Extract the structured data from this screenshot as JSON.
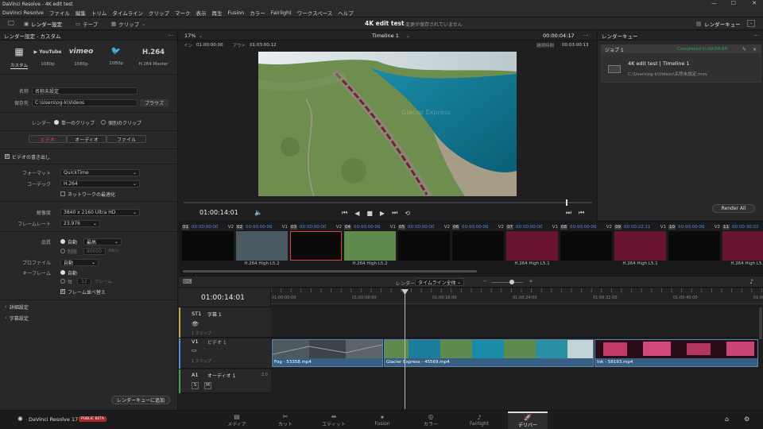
{
  "titlebar": {
    "app_title": "DaVinci Resolve - 4K edit test",
    "minimize": "—",
    "maximize": "☐",
    "close": "✕"
  },
  "menu": [
    "DaVinci Resolve",
    "ファイル",
    "編集",
    "トリム",
    "タイムライン",
    "クリップ",
    "マーク",
    "表示",
    "再生",
    "Fusion",
    "カラー",
    "Fairlight",
    "ワークスペース",
    "ヘルプ"
  ],
  "toolbar": {
    "render_settings": "レンダー設定",
    "tape": "テープ",
    "clips": "クリップ",
    "project_title": "4K edit test",
    "unsaved": "変更が保存されていません",
    "render_queue": "レンダーキュー"
  },
  "render": {
    "panel_title": "レンダー設定 - カスタム",
    "more": "···",
    "presets": [
      {
        "logo": "▦",
        "label": "カスタム"
      },
      {
        "logo": "▶ YouTube",
        "label": "1080p"
      },
      {
        "logo": "vimeo",
        "label": "1080p"
      },
      {
        "logo": "🐦",
        "label": "1080p"
      },
      {
        "logo": "H.264",
        "label": "H.264 Master"
      }
    ],
    "name_label": "名称",
    "name_value": "名称未設定",
    "location_label": "保存先",
    "location_value": "C:\\Users\\og-k\\Videos",
    "browse": "ブラウズ",
    "render_label": "レンダー",
    "single_clip": "単一のクリップ",
    "individual_clips": "個別のクリップ",
    "tabs": [
      "ビデオ",
      "オーディオ",
      "ファイル"
    ],
    "export_video": "ビデオの書き出し",
    "format_label": "フォーマット",
    "format_value": "QuickTime",
    "codec_label": "コーデック",
    "codec_value": "H.264",
    "network_opt": "ネットワークの最適化",
    "resolution_label": "解像度",
    "resolution_value": "3840 x 2160 Ultra HD",
    "framerate_label": "フレームレート",
    "framerate_value": "23.976",
    "quality_label": "品質",
    "auto": "自動",
    "quality_value": "最高",
    "limit_label": "制限",
    "limit_value": "80000",
    "kbs": "Kb/s",
    "profile_label": "プロファイル",
    "profile_value": "自動",
    "keyframe_label": "キーフレーム",
    "kf_auto": "自動",
    "kf_every": "毎",
    "kf_value": "12",
    "kf_frames": "フレーム",
    "reorder": "フレーム並べ替え",
    "advanced": "詳細設定",
    "subtitle_settings": "字幕設定",
    "add_queue": "レンダーキューに追加"
  },
  "viewer": {
    "zoom": "17%",
    "timeline_name": "Timeline 1",
    "timecode_top": "00:00:04:17",
    "in_label": "イン",
    "in_value": "01:00:00:00",
    "out_label": "アウト",
    "out_value": "01:03:00:12",
    "duration_label": "継続時間",
    "duration_value": "00:03:00:13",
    "current_tc": "01:00:14:01",
    "watermark": "Glacier Express"
  },
  "queue": {
    "title": "レンダーキュー",
    "job": "ジョブ 1",
    "completed": "Completed in 00:04:50",
    "job_title": "4K edit test | Timeline 1",
    "job_path": "C:\\Users\\og-k\\Videos\\名称未設定.mov",
    "render_all": "Render All"
  },
  "clips": [
    {
      "num": "01",
      "tc": "00:00:00:00",
      "track": "V2",
      "caption": ""
    },
    {
      "num": "02",
      "tc": "00:00:00:00",
      "track": "V1",
      "caption": "H.264 High L5.2"
    },
    {
      "num": "03",
      "tc": "00:00:00:00",
      "track": "V2",
      "caption": ""
    },
    {
      "num": "04",
      "tc": "00:00:00:00",
      "track": "V1",
      "caption": "H.264 High L5.2"
    },
    {
      "num": "05",
      "tc": "00:00:00:00",
      "track": "V2",
      "caption": ""
    },
    {
      "num": "06",
      "tc": "00:00:00:00",
      "track": "V2",
      "caption": ""
    },
    {
      "num": "07",
      "tc": "00:00:00:00",
      "track": "V1",
      "caption": "H.264 High L5.1"
    },
    {
      "num": "08",
      "tc": "00:00:00:00",
      "track": "V2",
      "caption": ""
    },
    {
      "num": "09",
      "tc": "00:00:22:11",
      "track": "V1",
      "caption": "H.264 High L5.1"
    },
    {
      "num": "10",
      "tc": "00:00:00:00",
      "track": "V2",
      "caption": ""
    },
    {
      "num": "11",
      "tc": "00:00:30:02",
      "track": "",
      "caption": "H.264 High L5.1"
    }
  ],
  "timeline": {
    "render_label": "レンダー",
    "render_value": "タイムライン全体",
    "current_tc": "01:00:14:01",
    "ruler": [
      "01:00:00:00",
      "01:00:08:00",
      "01:00:16:00",
      "01:00:24:00",
      "01:00:32:00",
      "01:00:40:00",
      "01:00:48:00"
    ],
    "st1": "ST1",
    "st1_name": "字幕 1",
    "st1_sub": "1 クリップ",
    "v1": "V1",
    "v1_name": "ビデオ 1",
    "v1_sub": "1 クリップ",
    "a1": "A1",
    "a1_name": "オーディオ 1",
    "a1_ch": "2.0",
    "s": "S",
    "m": "M",
    "clip1": "Fog - 53358.mp4",
    "clip2": "Glacier Express - 45569.mp4",
    "clip3": "Ink - 58193.mp4"
  },
  "footer": {
    "brand": "DaVinci Resolve 17",
    "beta": "PUBLIC BETA",
    "tabs": [
      {
        "icon": "▤",
        "label": "メディア"
      },
      {
        "icon": "✂",
        "label": "カット"
      },
      {
        "icon": "⇹",
        "label": "エディット"
      },
      {
        "icon": "✦",
        "label": "Fusion"
      },
      {
        "icon": "◎",
        "label": "カラー"
      },
      {
        "icon": "♪",
        "label": "Fairlight"
      },
      {
        "icon": "🚀",
        "label": "デリバー"
      }
    ]
  }
}
